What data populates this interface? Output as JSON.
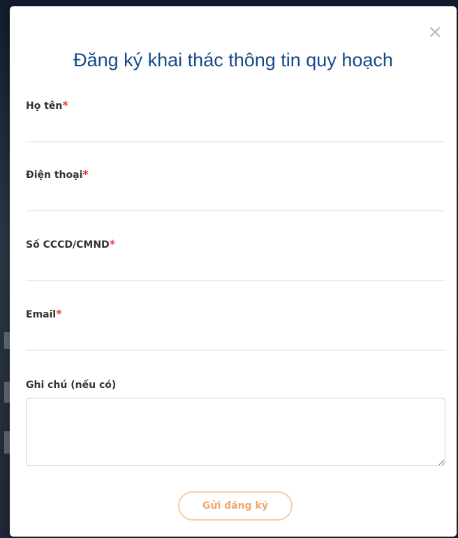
{
  "modal": {
    "title": "Đăng ký khai thác thông tin quy hoạch",
    "close_symbol": "×",
    "required_marker": "*"
  },
  "fields": [
    {
      "label": "Họ tên",
      "required": true,
      "value": "",
      "placeholder": ""
    },
    {
      "label": "Điện thoại",
      "required": true,
      "value": "",
      "placeholder": ""
    },
    {
      "label": "Số CCCD/CMND",
      "required": true,
      "value": "",
      "placeholder": ""
    },
    {
      "label": "Email",
      "required": true,
      "value": "",
      "placeholder": ""
    }
  ],
  "note": {
    "label": "Ghi chú (nếu có)",
    "value": ""
  },
  "submit": {
    "label": "Gửi đăng ký"
  },
  "colors": {
    "title": "#164a8a",
    "required": "#e53935",
    "button_border": "#f5cda7",
    "button_text": "#f2a86a"
  },
  "icons": {
    "close": "close-icon"
  }
}
